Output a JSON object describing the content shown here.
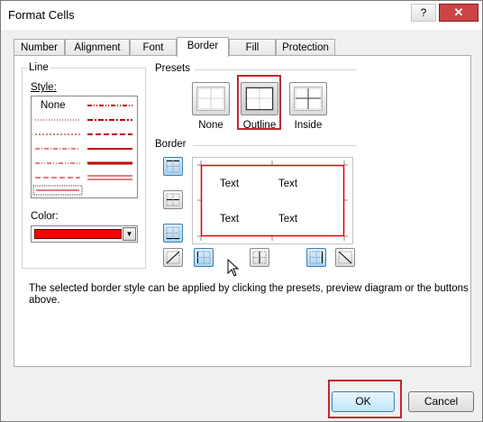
{
  "dialog": {
    "title": "Format Cells",
    "help_label": "?",
    "close_label": "✕"
  },
  "tabs": [
    {
      "label": "Number",
      "active": false
    },
    {
      "label": "Alignment",
      "active": false
    },
    {
      "label": "Font",
      "active": false
    },
    {
      "label": "Border",
      "active": true
    },
    {
      "label": "Fill",
      "active": false
    },
    {
      "label": "Protection",
      "active": false
    }
  ],
  "line_group": {
    "label": "Line",
    "style_label": "Style:",
    "none_label": "None",
    "color_label": "Color:",
    "selected_color": "#ff0000"
  },
  "presets": {
    "label": "Presets",
    "items": [
      {
        "label": "None",
        "selected": false
      },
      {
        "label": "Outline",
        "selected": true
      },
      {
        "label": "Inside",
        "selected": false
      }
    ]
  },
  "border": {
    "label": "Border",
    "preview_texts": [
      "Text",
      "Text",
      "Text",
      "Text"
    ]
  },
  "description": "The selected border style can be applied by clicking the presets, preview diagram or the buttons above.",
  "buttons": {
    "ok_label": "OK",
    "cancel_label": "Cancel"
  },
  "colors": {
    "accent_red": "#ff0000",
    "highlight_frame": "#c0282e",
    "toggle_on": "#a9d5f5"
  }
}
